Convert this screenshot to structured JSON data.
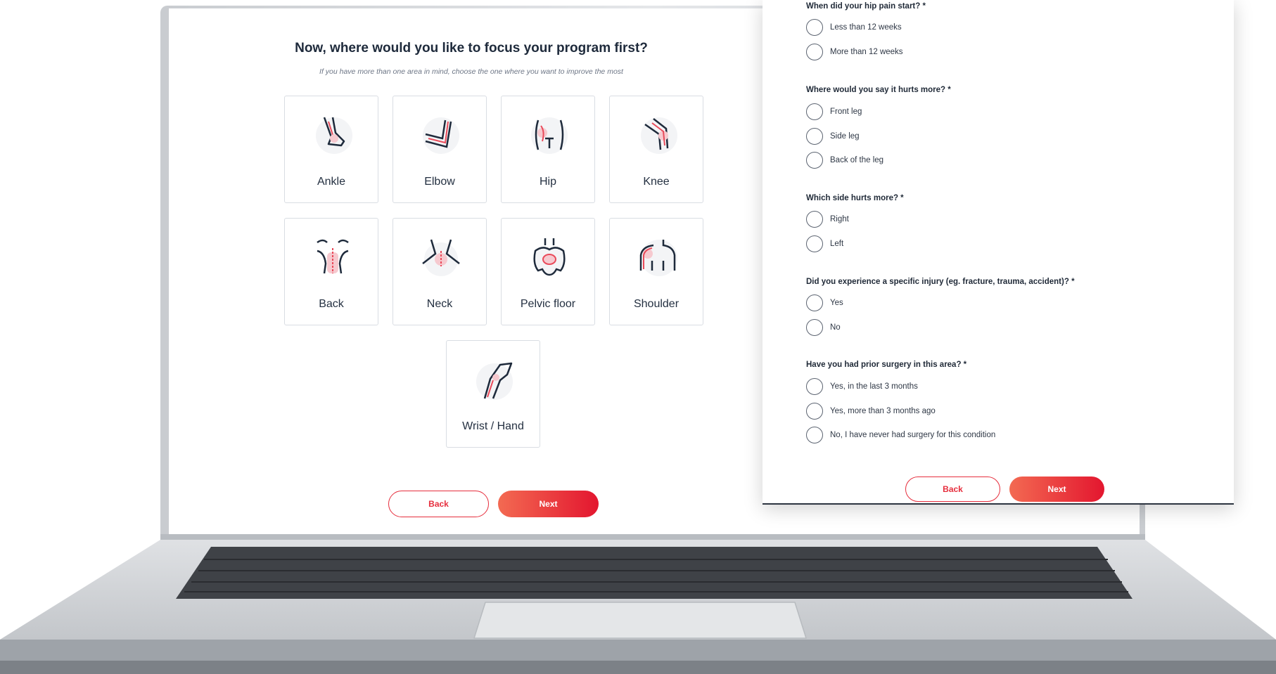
{
  "focus": {
    "title": "Now, where would you like to focus your program first?",
    "subtitle": "If you have more than one area in mind, choose the one where you want to improve the most",
    "areas": [
      {
        "label": "Ankle",
        "icon": "ankle-icon"
      },
      {
        "label": "Elbow",
        "icon": "elbow-icon"
      },
      {
        "label": "Hip",
        "icon": "hip-icon"
      },
      {
        "label": "Knee",
        "icon": "knee-icon"
      },
      {
        "label": "Back",
        "icon": "back-icon"
      },
      {
        "label": "Neck",
        "icon": "neck-icon"
      },
      {
        "label": "Pelvic floor",
        "icon": "pelvic-floor-icon"
      },
      {
        "label": "Shoulder",
        "icon": "shoulder-icon"
      },
      {
        "label": "Wrist / Hand",
        "icon": "wrist-hand-icon"
      }
    ],
    "back_label": "Back",
    "next_label": "Next"
  },
  "form": {
    "questions": [
      {
        "label": "When did your hip pain start? *",
        "options": [
          "Less than 12 weeks",
          "More than 12 weeks"
        ]
      },
      {
        "label": "Where would you say it hurts more? *",
        "options": [
          "Front leg",
          "Side leg",
          "Back of the leg"
        ]
      },
      {
        "label": "Which side hurts more? *",
        "options": [
          "Right",
          "Left"
        ]
      },
      {
        "label": "Did you experience a specific injury (eg. fracture, trauma, accident)? *",
        "options": [
          "Yes",
          "No"
        ]
      },
      {
        "label": "Have you had prior surgery in this area? *",
        "options": [
          "Yes, in the last 3 months",
          "Yes, more than 3 months ago",
          "No, I have never had surgery for this condition"
        ]
      }
    ],
    "back_label": "Back",
    "next_label": "Next"
  },
  "colors": {
    "accent": "#e3162f",
    "accent_light": "#f36a52",
    "icon_pink": "#f6c9cf",
    "text_dark": "#1e2a3b"
  }
}
